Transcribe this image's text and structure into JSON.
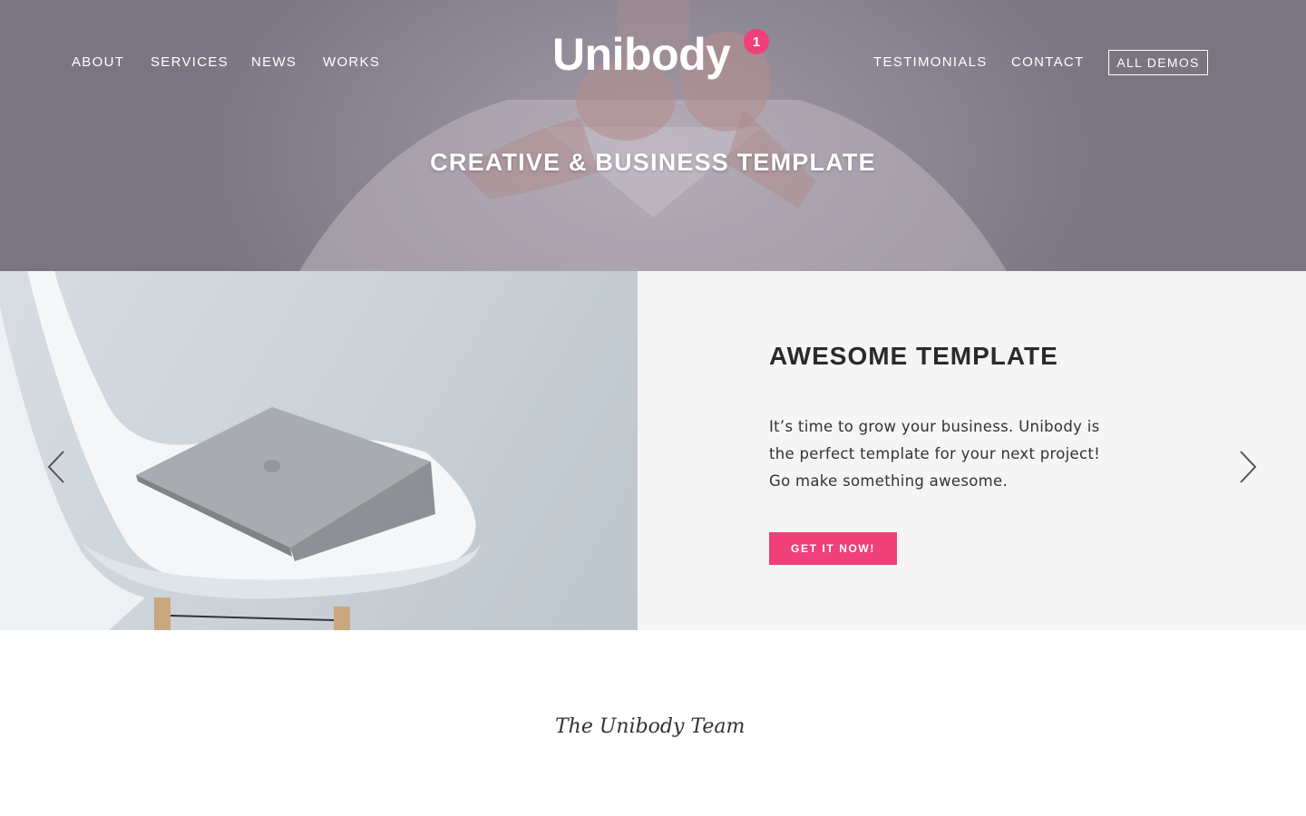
{
  "nav": {
    "left": [
      "About",
      "Services",
      "News",
      "Works"
    ],
    "right": [
      "Testimonials",
      "Contact"
    ],
    "demos_button": "All Demos"
  },
  "logo": {
    "text": "Unibody",
    "badge": "1"
  },
  "hero": {
    "tagline": "Creative & Business Template"
  },
  "slide": {
    "title": "Awesome Template",
    "text": "It’s time to grow your business. Unibody is the perfect template for your next project! Go make something awesome.",
    "cta": "Get it now!"
  },
  "signature": "The Unibody Team",
  "colors": {
    "accent": "#f0407a",
    "hero_overlay": "#8a8592",
    "panel_bg": "#f5f5f5",
    "heading": "#2a2a2a"
  },
  "icons": {
    "prev": "chevron-left-icon",
    "next": "chevron-right-icon"
  }
}
